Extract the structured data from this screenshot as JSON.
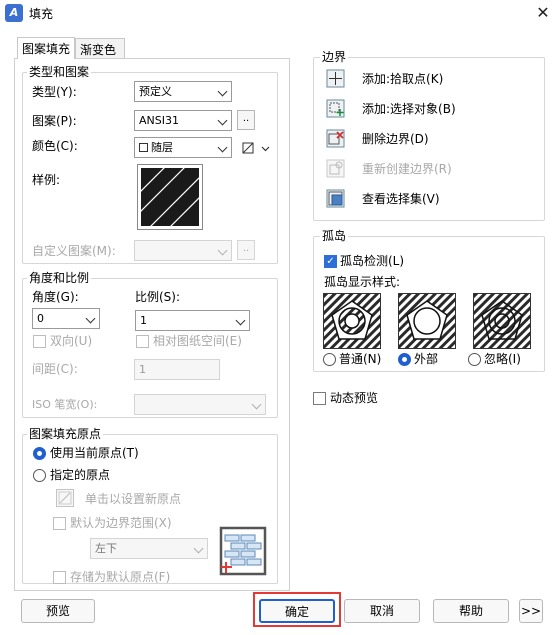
{
  "window": {
    "title": "填充",
    "app_icon_letter": "A"
  },
  "tabs": [
    {
      "label": "图案填充"
    },
    {
      "label": "渐变色"
    }
  ],
  "type_pattern": {
    "group_title": "类型和图案",
    "type_label": "类型(Y):",
    "type_value": "预定义",
    "pattern_label": "图案(P):",
    "pattern_value": "ANSI31",
    "pattern_btn": "..",
    "color_label": "颜色(C):",
    "color_value": "随层",
    "sample_label": "样例:",
    "custom_label": "自定义图案(M):",
    "custom_btn": ".."
  },
  "angle_scale": {
    "group_title": "角度和比例",
    "angle_label": "角度(G):",
    "angle_value": "0",
    "scale_label": "比例(S):",
    "scale_value": "1",
    "double_label": "双向(U)",
    "relative_label": "相对图纸空间(E)",
    "spacing_label": "间距(C):",
    "spacing_value": "1",
    "iso_label": "ISO 笔宽(O):"
  },
  "origin": {
    "group_title": "图案填充原点",
    "use_current": "使用当前原点(T)",
    "specified": "指定的原点",
    "click_set": "单击以设置新原点",
    "default_extent": "默认为边界范围(X)",
    "extent_value": "左下",
    "store_default": "存储为默认原点(F)"
  },
  "boundary": {
    "group_title": "边界",
    "add_pick": "添加:拾取点(K)",
    "add_select": "添加:选择对象(B)",
    "remove": "删除边界(D)",
    "recreate": "重新创建边界(R)",
    "view_select": "查看选择集(V)"
  },
  "islands": {
    "group_title": "孤岛",
    "detect_label": "孤岛检测(L)",
    "style_label": "孤岛显示样式:",
    "options": [
      {
        "label": "普通(N)"
      },
      {
        "label": "外部"
      },
      {
        "label": "忽略(I)"
      }
    ],
    "selected": "外部"
  },
  "preview_dynamic": "动态预览",
  "buttons": {
    "preview": "预览",
    "ok": "确定",
    "cancel": "取消",
    "help": "帮助",
    "more": ">>"
  },
  "colors": {
    "accent": "#1f5fd0",
    "highlight": "#e53935"
  }
}
